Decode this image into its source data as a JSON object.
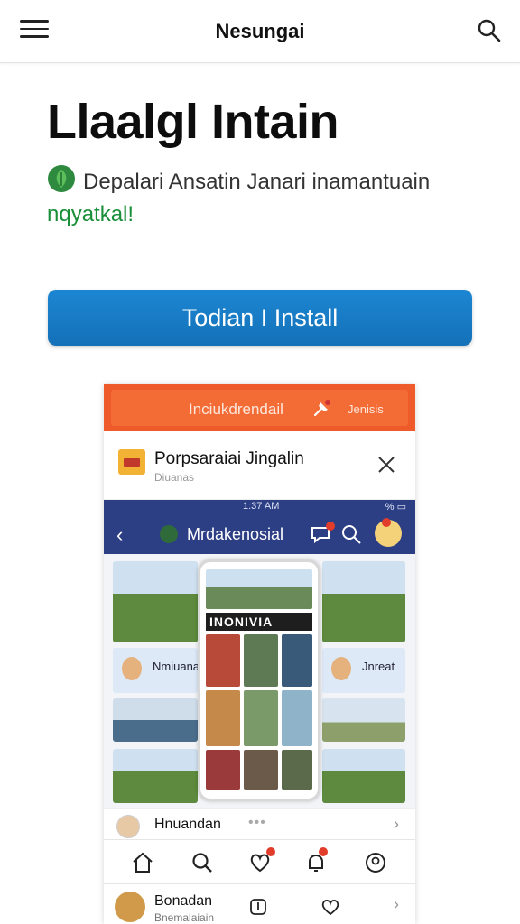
{
  "header": {
    "brand": "Nesungai",
    "menu_icon": "hamburger-menu-icon",
    "search_icon": "search-icon"
  },
  "hero": {
    "title": "Llaalgl Intain",
    "subtitle": "Depalari Ansatin Janari inamantuain",
    "subtitle_accent": "nqyatkal!",
    "leaf_icon": "leaf-icon",
    "accent_color": "#1a8f3a"
  },
  "cta": {
    "label": "Todian I Install",
    "color": "#1d86d2"
  },
  "mockup": {
    "banner": {
      "left_text": "Inciukdrendail",
      "right_text": "Jenisis",
      "color": "#ef5a2a"
    },
    "notification": {
      "title": "Porpsaraiai Jingalin",
      "subtitle": "Diuanas"
    },
    "status_bar": {
      "time": "1:37 AM",
      "battery": "% ▭"
    },
    "app_bar": {
      "name": "Mrdakenosial",
      "back_icon": "back-arrow-icon",
      "bar_color": "#2c3e84"
    },
    "grid": {
      "card_left_label": "Nmiuana",
      "card_right_label": "Jnreat",
      "phone_label": "INONIVIA"
    },
    "row1": {
      "name": "Hnuandan",
      "more": "•••",
      "chevron": "›"
    },
    "tabs": [
      "home-icon",
      "search-icon",
      "heart-icon",
      "notification-bell-icon",
      "profile-icon"
    ],
    "row2": {
      "name": "Bonadan",
      "subtitle": "Bnemalaiain",
      "chevron": "›"
    }
  }
}
